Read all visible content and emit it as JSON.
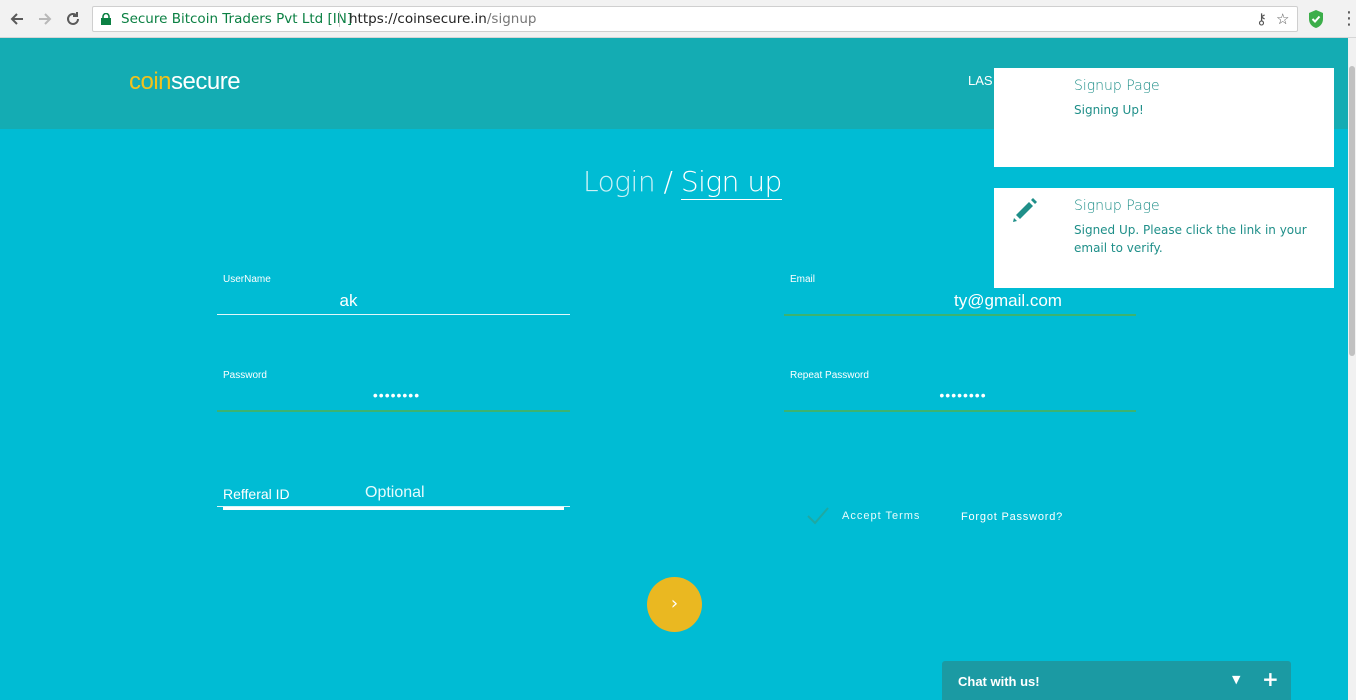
{
  "browser": {
    "back_icon": "arrow-left-icon",
    "forward_icon": "arrow-right-icon",
    "reload_icon": "reload-icon",
    "secure_label": "Secure Bitcoin Traders Pvt Ltd [IN]",
    "url_host": "https://coinsecure.in",
    "url_path": "/signup"
  },
  "header": {
    "logo_coin": "coin",
    "logo_secure": "secure",
    "nav_partial": "LAS"
  },
  "page": {
    "title_login": "Login",
    "title_sep": " / ",
    "title_signup": "Sign up"
  },
  "form": {
    "username": {
      "label": "UserName",
      "value": "ak"
    },
    "email": {
      "label": "Email",
      "value": "ty@gmail.com"
    },
    "password": {
      "label": "Password",
      "value": "••••••••"
    },
    "repeat_password": {
      "label": "Repeat Password",
      "value": "••••••••"
    },
    "referral": {
      "label": "Refferal ID",
      "placeholder": "Optional"
    },
    "accept_terms": "Accept Terms",
    "forgot_password": "Forgot Password?",
    "submit": "›"
  },
  "notifications": [
    {
      "title": "Signup Page",
      "message": "Signing Up!"
    },
    {
      "title": "Signup Page",
      "message": "Signed Up. Please click the link in your email to verify."
    }
  ],
  "chat": {
    "label": "Chat with us!",
    "minimize": "▼",
    "expand": "+"
  },
  "colors": {
    "background": "#00bcd4",
    "header": "#14acb3",
    "accent_yellow": "#eab821",
    "valid_green": "#3cb371"
  }
}
